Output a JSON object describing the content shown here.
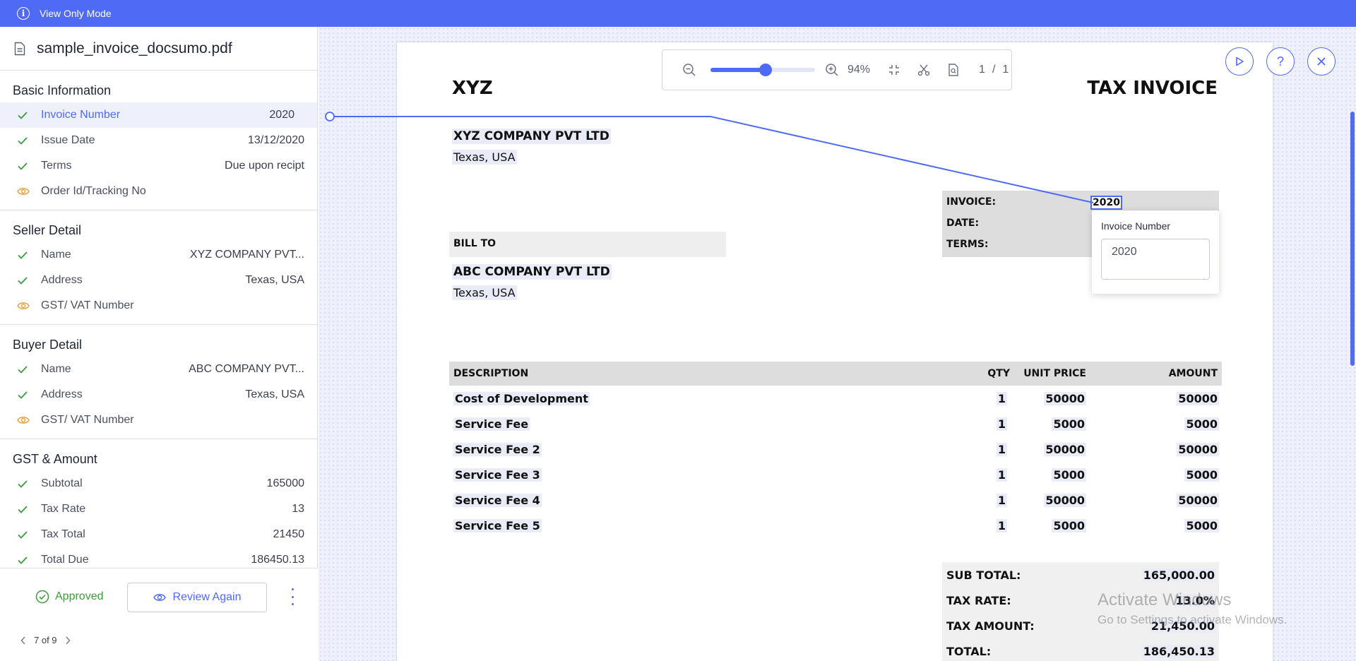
{
  "banner": {
    "text": "View Only Mode"
  },
  "file": {
    "name": "sample_invoice_docsumo.pdf"
  },
  "sections": [
    {
      "title": "Basic Information",
      "fields": [
        {
          "label": "Invoice Number",
          "value": "2020",
          "status": "check",
          "active": true
        },
        {
          "label": "Issue Date",
          "value": "13/12/2020",
          "status": "check"
        },
        {
          "label": "Terms",
          "value": "Due upon recipt",
          "status": "check"
        },
        {
          "label": "Order Id/Tracking No",
          "value": "",
          "status": "eye"
        }
      ]
    },
    {
      "title": "Seller Detail",
      "fields": [
        {
          "label": "Name",
          "value": "XYZ COMPANY PVT...",
          "status": "check"
        },
        {
          "label": "Address",
          "value": "Texas, USA",
          "status": "check"
        },
        {
          "label": "GST/ VAT Number",
          "value": "",
          "status": "eye"
        }
      ]
    },
    {
      "title": "Buyer Detail",
      "fields": [
        {
          "label": "Name",
          "value": "ABC COMPANY PVT...",
          "status": "check"
        },
        {
          "label": "Address",
          "value": "Texas, USA",
          "status": "check"
        },
        {
          "label": "GST/ VAT Number",
          "value": "",
          "status": "eye"
        }
      ]
    },
    {
      "title": "GST & Amount",
      "fields": [
        {
          "label": "Subtotal",
          "value": "165000",
          "status": "check"
        },
        {
          "label": "Tax Rate",
          "value": "13",
          "status": "check"
        },
        {
          "label": "Tax Total",
          "value": "21450",
          "status": "check"
        },
        {
          "label": "Total Due",
          "value": "186450.13",
          "status": "check"
        }
      ]
    }
  ],
  "footer": {
    "approved": "Approved",
    "review": "Review Again"
  },
  "pager": {
    "text": "7 of 9"
  },
  "toolbar": {
    "zoom": "94%",
    "page_current": "1",
    "page_sep": "/",
    "page_total": "1",
    "zoom_level": 0.53
  },
  "invoice": {
    "company": "XYZ",
    "title": "TAX INVOICE",
    "seller_name": "XYZ COMPANY PVT LTD",
    "seller_address": "Texas, USA",
    "invoice_label": "INVOICE:",
    "invoice_value": "2020",
    "date_label": "DATE:",
    "terms_label": "TERMS:",
    "bill_to": "BILL TO",
    "buyer_name": "ABC COMPANY PVT LTD",
    "buyer_address": "Texas, USA",
    "columns": {
      "description": "DESCRIPTION",
      "qty": "QTY",
      "unit_price": "UNIT PRICE",
      "amount": "AMOUNT"
    },
    "items": [
      {
        "description": "Cost of Development",
        "qty": "1",
        "unit_price": "50000",
        "amount": "50000"
      },
      {
        "description": "Service Fee",
        "qty": "1",
        "unit_price": "5000",
        "amount": "5000"
      },
      {
        "description": "Service Fee 2",
        "qty": "1",
        "unit_price": "50000",
        "amount": "50000"
      },
      {
        "description": "Service Fee 3",
        "qty": "1",
        "unit_price": "5000",
        "amount": "5000"
      },
      {
        "description": "Service Fee 4",
        "qty": "1",
        "unit_price": "50000",
        "amount": "50000"
      },
      {
        "description": "Service Fee 5",
        "qty": "1",
        "unit_price": "5000",
        "amount": "5000"
      }
    ],
    "totals": [
      {
        "label": "SUB TOTAL:",
        "value": "165,000.00"
      },
      {
        "label": "TAX RATE:",
        "value": "13.0%"
      },
      {
        "label": "TAX AMOUNT:",
        "value": "21,450.00"
      },
      {
        "label": "TOTAL:",
        "value": "186,450.13"
      }
    ]
  },
  "popup": {
    "label": "Invoice Number",
    "value": "2020"
  },
  "watermark": {
    "line1": "Activate Windows",
    "line2": "Go to Settings to activate Windows."
  },
  "colors": {
    "accent": "#4f6af5",
    "check": "#3b9a3b",
    "eye": "#e8a33a"
  }
}
